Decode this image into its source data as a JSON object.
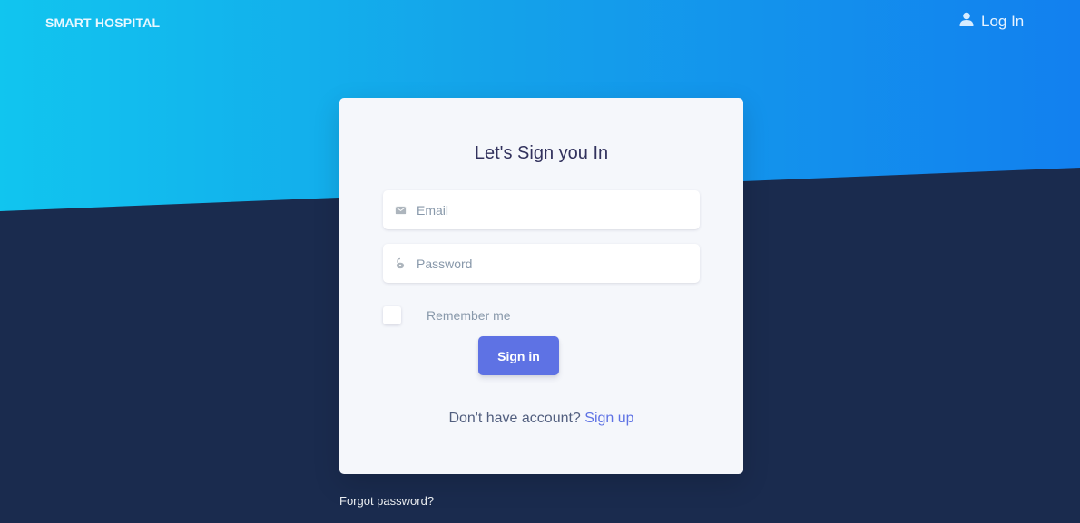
{
  "header": {
    "brand": "SMART HOSPITAL",
    "login_label": "Log In"
  },
  "card": {
    "title": "Let's Sign you In",
    "email": {
      "placeholder": "Email",
      "value": ""
    },
    "password": {
      "placeholder": "Password",
      "value": ""
    },
    "remember_label": "Remember me",
    "remember_checked": false,
    "signin_label": "Sign in",
    "no_account_text": "Don't have account?",
    "signup_label": "Sign up"
  },
  "footer": {
    "forgot_label": "Forgot password?"
  },
  "icons": {
    "login": "user-icon",
    "email": "envelope-icon",
    "password": "lock-icon"
  },
  "colors": {
    "gradient_start": "#11c5ef",
    "gradient_end": "#1280ef",
    "background_dark": "#1a2b4e",
    "accent": "#5e72e4"
  }
}
